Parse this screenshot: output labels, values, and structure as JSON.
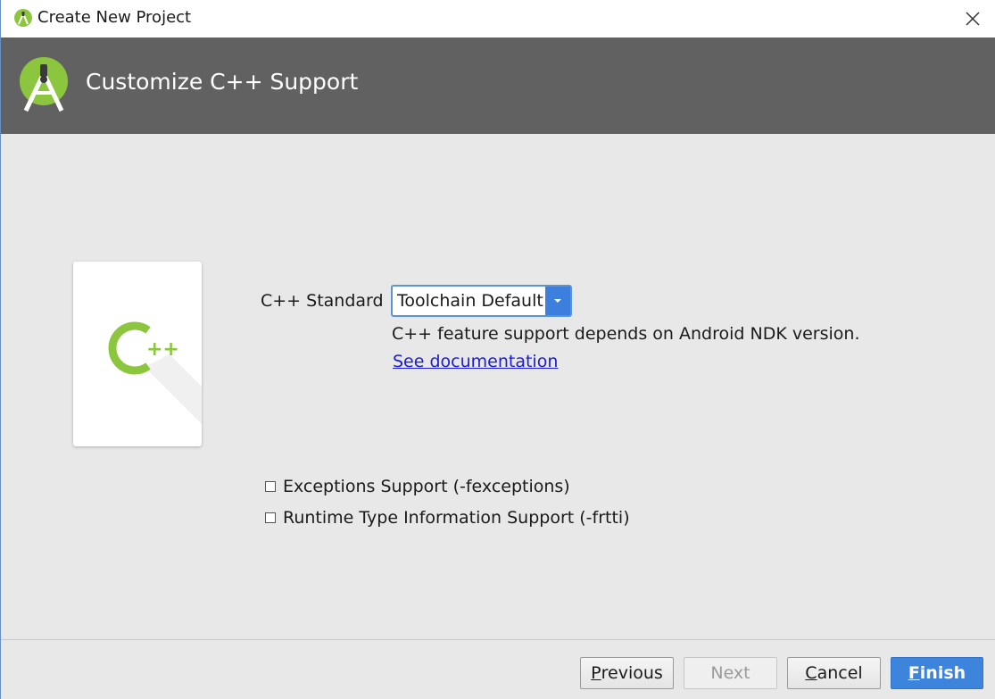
{
  "window": {
    "title": "Create New Project",
    "close_icon": "close-icon"
  },
  "header": {
    "heading": "Customize C++ Support",
    "logo_icon": "android-studio-logo"
  },
  "card": {
    "icon": "cpp-icon",
    "glyph_c": "C",
    "glyph_pp": "++"
  },
  "form": {
    "cpp_standard_label": "C++ Standard",
    "cpp_standard_value": "Toolchain Default",
    "hint": "C++ feature support depends on Android NDK version.",
    "doc_link": "See documentation",
    "exceptions_label": "Exceptions Support (-fexceptions)",
    "exceptions_checked": false,
    "rtti_label": "Runtime Type Information Support (-frtti)",
    "rtti_checked": false
  },
  "footer": {
    "previous_first": "P",
    "previous_rest": "revious",
    "next": "Next",
    "cancel_first": "C",
    "cancel_rest": "ancel",
    "finish_first": "F",
    "finish_rest": "inish"
  },
  "colors": {
    "header_bg": "#616161",
    "android_green": "#8cc63f",
    "accent_blue": "#3d84dc",
    "link": "#1a1bd8"
  }
}
